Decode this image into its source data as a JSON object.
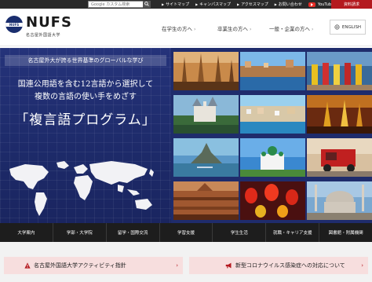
{
  "topbar": {
    "search_placeholder": "Google カスタム検索",
    "links": [
      {
        "label": "サイトマップ"
      },
      {
        "label": "キャンパスマップ"
      },
      {
        "label": "アクセスマップ"
      },
      {
        "label": "お問い合わせ"
      }
    ],
    "youtube_label": "YouTube",
    "request_label": "資料請求",
    "colors": {
      "bar": "#2a2a2a",
      "request": "#b4191f",
      "youtube": "#e52d27"
    }
  },
  "header": {
    "logo_name": "NUFS",
    "logo_sub": "名古屋外国語大学",
    "nav": [
      {
        "label": "在学生の方へ"
      },
      {
        "label": "卒業生の方へ"
      },
      {
        "label": "一般・企業の方へ"
      }
    ],
    "lang_label": "ENGLISH"
  },
  "hero": {
    "tagline": "名古屋外大が誇る世界基準のグローバルな学び",
    "lead1": "国連公用語を含む12言語から選択して",
    "lead2": "複数の言語の使い手をめざす",
    "program": "「複言語プログラム」",
    "photos": [
      {
        "icon": "church-photo"
      },
      {
        "icon": "city-canal-photo"
      },
      {
        "icon": "dancers-photo"
      },
      {
        "icon": "castle-photo"
      },
      {
        "icon": "coastal-city-photo"
      },
      {
        "icon": "thai-dancers-photo"
      },
      {
        "icon": "abbey-island-photo"
      },
      {
        "icon": "orthodox-church-photo"
      },
      {
        "icon": "tuktuk-photo"
      },
      {
        "icon": "rooftops-photo"
      },
      {
        "icon": "lanterns-photo"
      },
      {
        "icon": "mosque-photo"
      }
    ]
  },
  "bottom_nav": [
    {
      "label": "大学案内"
    },
    {
      "label": "学部・大学院"
    },
    {
      "label": "留学・国際交流"
    },
    {
      "label": "学習支援"
    },
    {
      "label": "学生生活"
    },
    {
      "label": "就職・キャリア支援"
    },
    {
      "label": "図書館・附属機関"
    }
  ],
  "banners": [
    {
      "label": "名古屋外国語大学アクティビティ指針"
    },
    {
      "label": "新型コロナウイルス感染症への対応について"
    }
  ]
}
